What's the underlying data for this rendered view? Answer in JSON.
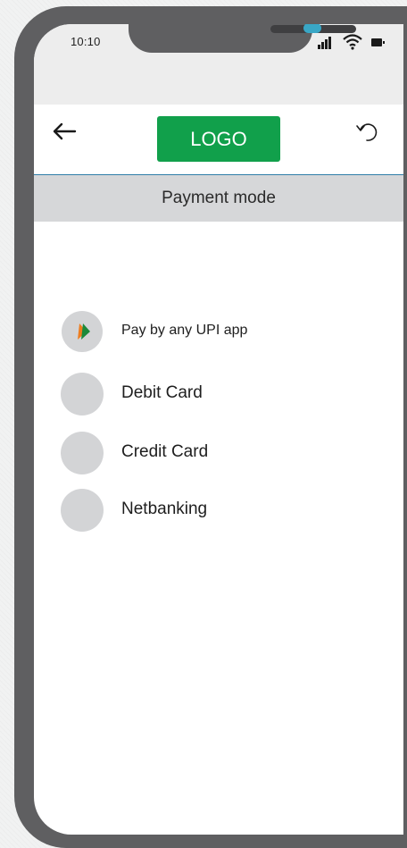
{
  "status_bar": {
    "time": "10:10",
    "icons": [
      "signal-icon",
      "wifi-icon",
      "battery-icon"
    ]
  },
  "header": {
    "logo_text": "LOGO",
    "back_icon": "back-arrow-icon",
    "refresh_icon": "refresh-icon"
  },
  "title_bar": {
    "title": "Payment mode"
  },
  "payment_options": [
    {
      "label": "Pay by any UPI app",
      "icon": "upi-icon"
    },
    {
      "label": "Debit Card",
      "icon": ""
    },
    {
      "label": "Credit Card",
      "icon": ""
    },
    {
      "label": "Netbanking",
      "icon": ""
    }
  ],
  "colors": {
    "logo_bg": "#11a04b",
    "title_bar_bg": "#d6d7d9",
    "phone_frame": "#5f5f61",
    "camera": "#39a7c6",
    "header_rule": "#2f7da8"
  }
}
